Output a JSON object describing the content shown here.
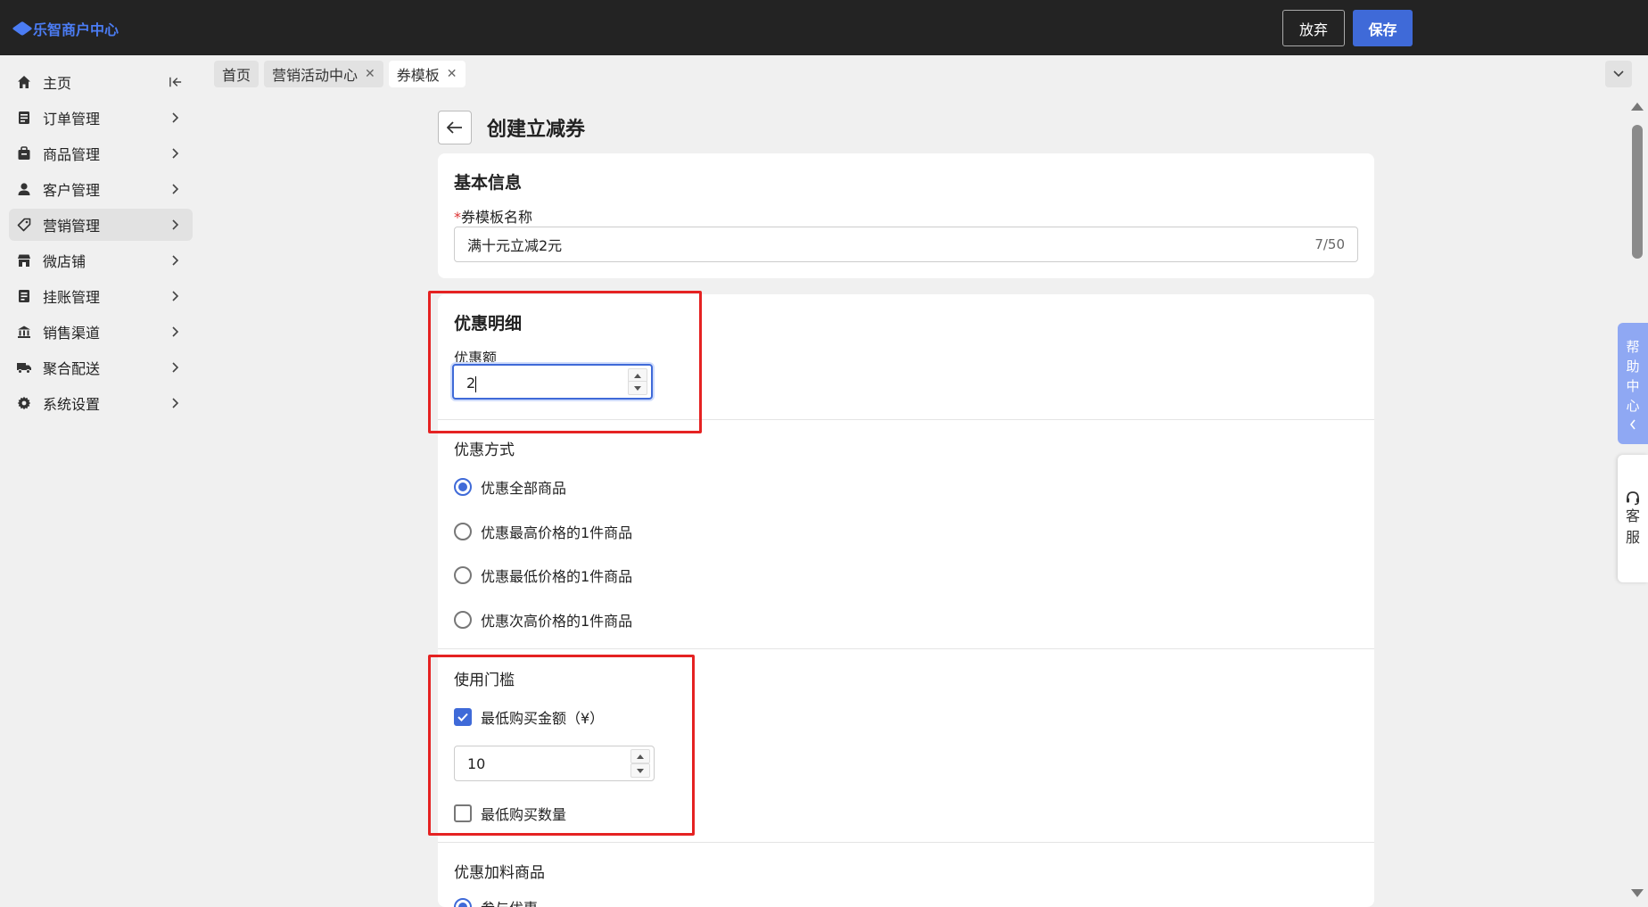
{
  "app": {
    "logo_text": "乐智商户中心",
    "brand_color": "#4b7cf3",
    "accent_color": "#3f6ad8",
    "highlight_color": "#e52222"
  },
  "header": {
    "discard_label": "放弃",
    "save_label": "保存"
  },
  "sidebar": {
    "items": [
      {
        "label": "主页",
        "icon": "home-icon",
        "active": false
      },
      {
        "label": "订单管理",
        "icon": "order-icon",
        "active": false
      },
      {
        "label": "商品管理",
        "icon": "goods-icon",
        "active": false
      },
      {
        "label": "客户管理",
        "icon": "user-icon",
        "active": false
      },
      {
        "label": "营销管理",
        "icon": "tag-icon",
        "active": true
      },
      {
        "label": "微店铺",
        "icon": "store-icon",
        "active": false
      },
      {
        "label": "挂账管理",
        "icon": "ledger-icon",
        "active": false
      },
      {
        "label": "销售渠道",
        "icon": "bank-icon",
        "active": false
      },
      {
        "label": "聚合配送",
        "icon": "truck-icon",
        "active": false
      },
      {
        "label": "系统设置",
        "icon": "gear-icon",
        "active": false
      }
    ]
  },
  "tabs": [
    {
      "label": "首页",
      "closable": false
    },
    {
      "label": "营销活动中心",
      "closable": true
    },
    {
      "label": "券模板",
      "closable": true,
      "current": true
    }
  ],
  "page": {
    "title": "创建立减券"
  },
  "basic_info": {
    "title": "基本信息",
    "required_mark": "*",
    "name_label": "券模板名称",
    "name_value": "满十元立减2元",
    "name_count": "7/50"
  },
  "discount_detail": {
    "title": "优惠明细",
    "amount_label": "优惠额",
    "amount_value": "2"
  },
  "discount_mode": {
    "label": "优惠方式",
    "options": [
      {
        "label": "优惠全部商品",
        "checked": true
      },
      {
        "label": "优惠最高价格的1件商品",
        "checked": false
      },
      {
        "label": "优惠最低价格的1件商品",
        "checked": false
      },
      {
        "label": "优惠次高价格的1件商品",
        "checked": false
      }
    ]
  },
  "threshold": {
    "label": "使用门槛",
    "min_amount_label": "最低购买金额（¥）",
    "min_amount_checked": true,
    "min_amount_value": "10",
    "min_qty_label": "最低购买数量",
    "min_qty_checked": false
  },
  "addon": {
    "label": "优惠加料商品",
    "first_option": "参与优惠"
  },
  "floating": {
    "help_chars": [
      "帮",
      "助",
      "中",
      "心"
    ],
    "service_chars": [
      "客",
      "服"
    ]
  }
}
